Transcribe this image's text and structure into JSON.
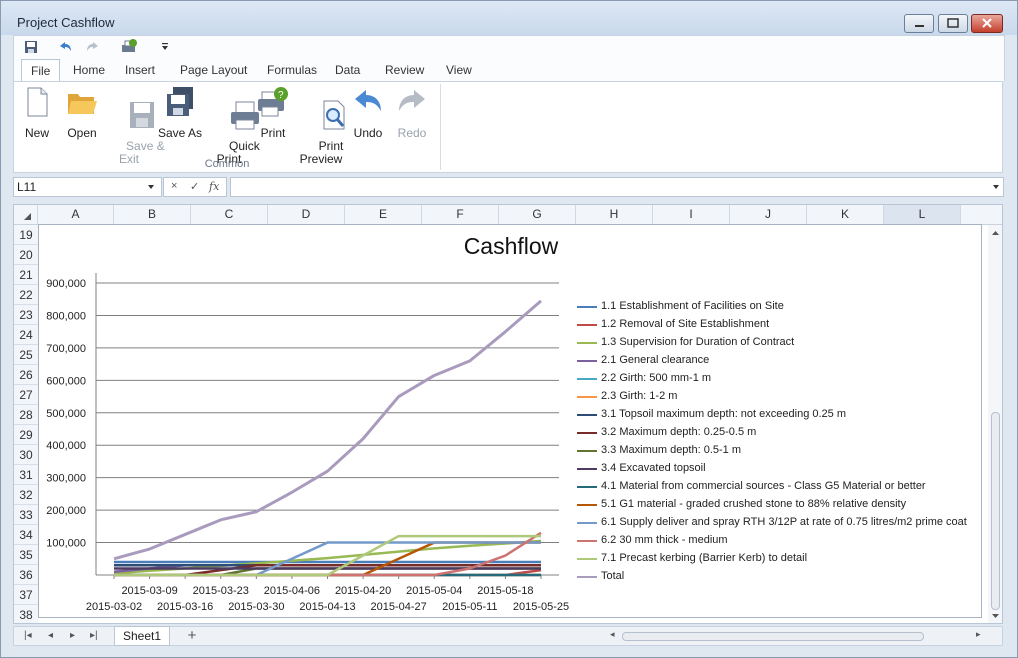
{
  "window": {
    "title": "Project Cashflow"
  },
  "ribbon_tabs": [
    "File",
    "Home",
    "Insert",
    "Page Layout",
    "Formulas",
    "Data",
    "Review",
    "View"
  ],
  "ribbon": {
    "buttons": [
      {
        "label": "New",
        "icon": "new-document-icon",
        "enabled": true
      },
      {
        "label": "Open",
        "icon": "open-folder-icon",
        "enabled": true
      },
      {
        "label": "Save &\nExit",
        "icon": "save-exit-icon",
        "enabled": false
      },
      {
        "label": "Save As",
        "icon": "save-as-icon",
        "enabled": true
      },
      {
        "label": "Quick\nPrint",
        "icon": "quick-print-icon",
        "enabled": true
      },
      {
        "label": "Print",
        "icon": "print-icon",
        "enabled": true
      },
      {
        "label": "Print\nPreview",
        "icon": "print-preview-icon",
        "enabled": true
      },
      {
        "label": "Undo",
        "icon": "undo-icon",
        "enabled": true
      },
      {
        "label": "Redo",
        "icon": "redo-icon",
        "enabled": false
      }
    ],
    "group_label": "Common"
  },
  "formula_bar": {
    "name_box": "L11",
    "cancel": "×",
    "enter": "✓",
    "fx": "fx",
    "formula": ""
  },
  "columns": [
    "A",
    "B",
    "C",
    "D",
    "E",
    "F",
    "G",
    "H",
    "I",
    "J",
    "K",
    "L"
  ],
  "selected_column": "L",
  "rows": [
    "19",
    "20",
    "21",
    "22",
    "23",
    "24",
    "25",
    "26",
    "27",
    "28",
    "29",
    "30",
    "31",
    "32",
    "33",
    "34",
    "35",
    "36",
    "37",
    "38"
  ],
  "sheet": {
    "tab": "Sheet1",
    "add": "+"
  },
  "colors": {
    "accent": "#2b579a",
    "window_bg": "#dfe7f1",
    "grid_line": "#7f7f7f"
  },
  "chart_data": {
    "type": "line",
    "title": "Cashflow",
    "x": [
      "2015-03-02",
      "2015-03-09",
      "2015-03-16",
      "2015-03-23",
      "2015-03-30",
      "2015-04-06",
      "2015-04-13",
      "2015-04-20",
      "2015-04-27",
      "2015-05-04",
      "2015-05-11",
      "2015-05-18",
      "2015-05-25"
    ],
    "y_ticks": [
      "100,000",
      "200,000",
      "300,000",
      "400,000",
      "500,000",
      "600,000",
      "700,000",
      "800,000",
      "900,000"
    ],
    "ylim": [
      0,
      900000
    ],
    "grid": true,
    "legend": "right",
    "series": [
      {
        "name": "1.1 Establishment of Facilities on Site",
        "color": "#4a7ebb",
        "values": [
          40000,
          40000,
          40000,
          40000,
          40000,
          40000,
          40000,
          40000,
          40000,
          40000,
          40000,
          40000,
          40000
        ]
      },
      {
        "name": "1.2 Removal of Site Establishment",
        "color": "#be4b48",
        "values": [
          0,
          0,
          0,
          0,
          0,
          0,
          0,
          0,
          0,
          0,
          0,
          0,
          15000
        ]
      },
      {
        "name": "1.3 Supervision for Duration of Contract",
        "color": "#98b954",
        "values": [
          5000,
          13000,
          20000,
          28000,
          36000,
          44000,
          52000,
          62000,
          72000,
          82000,
          90000,
          97000,
          105000
        ]
      },
      {
        "name": "2.1 General clearance",
        "color": "#7d60a0",
        "values": [
          10000,
          20000,
          30000,
          30000,
          30000,
          30000,
          30000,
          30000,
          30000,
          30000,
          30000,
          30000,
          30000
        ]
      },
      {
        "name": "2.2 Girth: 500 mm-1 m",
        "color": "#46aac5",
        "values": [
          0,
          0,
          0,
          0,
          0,
          0,
          0,
          0,
          0,
          0,
          0,
          0,
          0
        ]
      },
      {
        "name": "2.3 Girth: 1-2 m",
        "color": "#f79646",
        "values": [
          0,
          0,
          0,
          0,
          0,
          0,
          0,
          0,
          0,
          0,
          0,
          0,
          0
        ]
      },
      {
        "name": "3.1 Topsoil maximum depth: not exceeding 0.25 m",
        "color": "#2c4d75",
        "values": [
          30000,
          30000,
          30000,
          30000,
          30000,
          30000,
          30000,
          30000,
          30000,
          30000,
          30000,
          30000,
          30000
        ]
      },
      {
        "name": "3.2 Maximum depth: 0.25-0.5 m",
        "color": "#772c2a",
        "values": [
          0,
          0,
          0,
          15000,
          30000,
          30000,
          30000,
          30000,
          30000,
          30000,
          30000,
          30000,
          30000
        ]
      },
      {
        "name": "3.3 Maximum depth: 0.5-1 m",
        "color": "#5f7530",
        "values": [
          0,
          0,
          0,
          0,
          20000,
          20000,
          20000,
          20000,
          20000,
          20000,
          20000,
          20000,
          20000
        ]
      },
      {
        "name": "3.4 Excavated topsoil",
        "color": "#4d3b62",
        "values": [
          20000,
          20000,
          20000,
          20000,
          20000,
          20000,
          20000,
          20000,
          20000,
          20000,
          20000,
          20000,
          20000
        ]
      },
      {
        "name": "4.1 Material from commercial sources - Class G5 Material or better",
        "color": "#276a7c",
        "values": [
          0,
          0,
          0,
          0,
          0,
          0,
          0,
          0,
          0,
          0,
          0,
          0,
          0
        ]
      },
      {
        "name": "5.1 G1 material - graded crushed stone to 88% relative density",
        "color": "#b65708",
        "values": [
          0,
          0,
          0,
          0,
          0,
          0,
          0,
          0,
          50000,
          100000,
          100000,
          100000,
          100000
        ]
      },
      {
        "name": "6.1 Supply deliver and spray RTH 3/12P at rate of 0.75 litres/m2 prime coat",
        "color": "#729aca",
        "values": [
          0,
          0,
          0,
          0,
          0,
          50000,
          100000,
          100000,
          100000,
          100000,
          100000,
          100000,
          100000
        ]
      },
      {
        "name": "6.2 30 mm thick - medium",
        "color": "#cd7371",
        "values": [
          0,
          0,
          0,
          0,
          0,
          0,
          0,
          0,
          0,
          0,
          20000,
          60000,
          130000
        ]
      },
      {
        "name": "7.1 Precast kerbing (Barrier Kerb) to detail",
        "color": "#afc97a",
        "values": [
          0,
          0,
          0,
          0,
          0,
          0,
          0,
          60000,
          120000,
          120000,
          120000,
          120000,
          120000
        ]
      },
      {
        "name": "Total",
        "color": "#a99bbd",
        "values": [
          50000,
          80000,
          125000,
          170000,
          195000,
          255000,
          320000,
          420000,
          550000,
          615000,
          660000,
          750000,
          845000
        ]
      }
    ]
  }
}
